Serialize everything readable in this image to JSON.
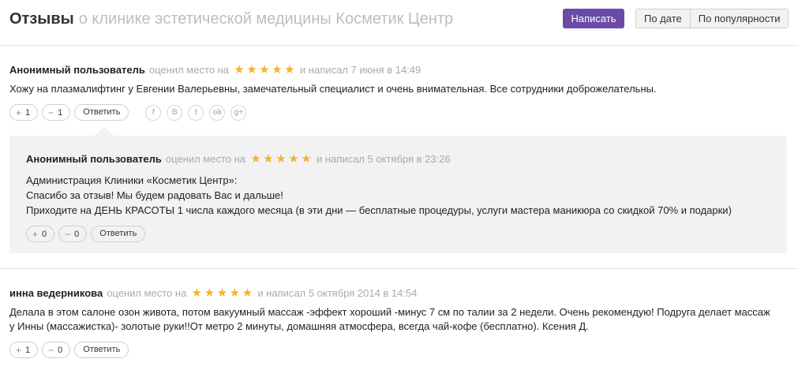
{
  "header": {
    "title": "Отзывы",
    "subtitle": "о клинике эстетической медицины Косметик Центр",
    "write_button": "Написать",
    "sort_by_date": "По дате",
    "sort_by_popularity": "По популярности"
  },
  "reviews": [
    {
      "author": "Анонимный пользователь",
      "rated_text": "оценил место на",
      "rating": 5,
      "wrote_text": "и написал 7 июня в 14:49",
      "text_lines": [
        "Хожу на плазмалифтинг у Евгении Валерьевны, замечательный специалист и очень внимательная. Все сотрудники доброжелательны."
      ],
      "plus": "+",
      "minus": "−",
      "likes": "1",
      "dislikes": "1",
      "reply_label": "Ответить",
      "socials": [
        "f",
        "B",
        "t",
        "ok",
        "g+"
      ]
    },
    {
      "author": "инна ведерникова",
      "rated_text": "оценил место на",
      "rating": 5,
      "wrote_text": "и написал 5 октября 2014 в 14:54",
      "text_lines": [
        "Делала в этом салоне озон живота, потом вакуумный массаж -эффект хороший -минус 7 см по талии за 2 недели. Очень рекомендую! Подруга делает массаж",
        "у Инны (массажистка)- золотые руки!!От метро 2 минуты, домашняя атмосфера, всегда чай-кофе (бесплатно). Ксения Д."
      ],
      "plus": "+",
      "minus": "−",
      "likes": "1",
      "dislikes": "0",
      "reply_label": "Ответить"
    }
  ],
  "answer": {
    "author": "Анонимный пользователь",
    "rated_text": "оценил место на",
    "rating": 5,
    "wrote_text": "и написал 5 октября в 23:26",
    "text_lines": [
      "Администрация Клиники «Косметик Центр»:",
      "Спасибо за отзыв! Мы будем радовать Вас и дальше!",
      "Приходите на ДЕНЬ КРАСОТЫ 1 числа каждого месяца (в эти дни — бесплатные процедуры, услуги мастера маникюра со скидкой 70% и подарки)"
    ],
    "plus": "+",
    "minus": "−",
    "likes": "0",
    "dislikes": "0",
    "reply_label": "Ответить"
  },
  "colors": {
    "accent": "#6b4ba5",
    "star": "#f3b32b",
    "answer_bg": "#f2f2f4"
  },
  "icons": {
    "star": "star-icon",
    "facebook": "facebook-icon",
    "vk": "vk-icon",
    "twitter": "twitter-icon",
    "odnoklassniki": "odnoklassniki-icon",
    "googleplus": "googleplus-icon"
  }
}
